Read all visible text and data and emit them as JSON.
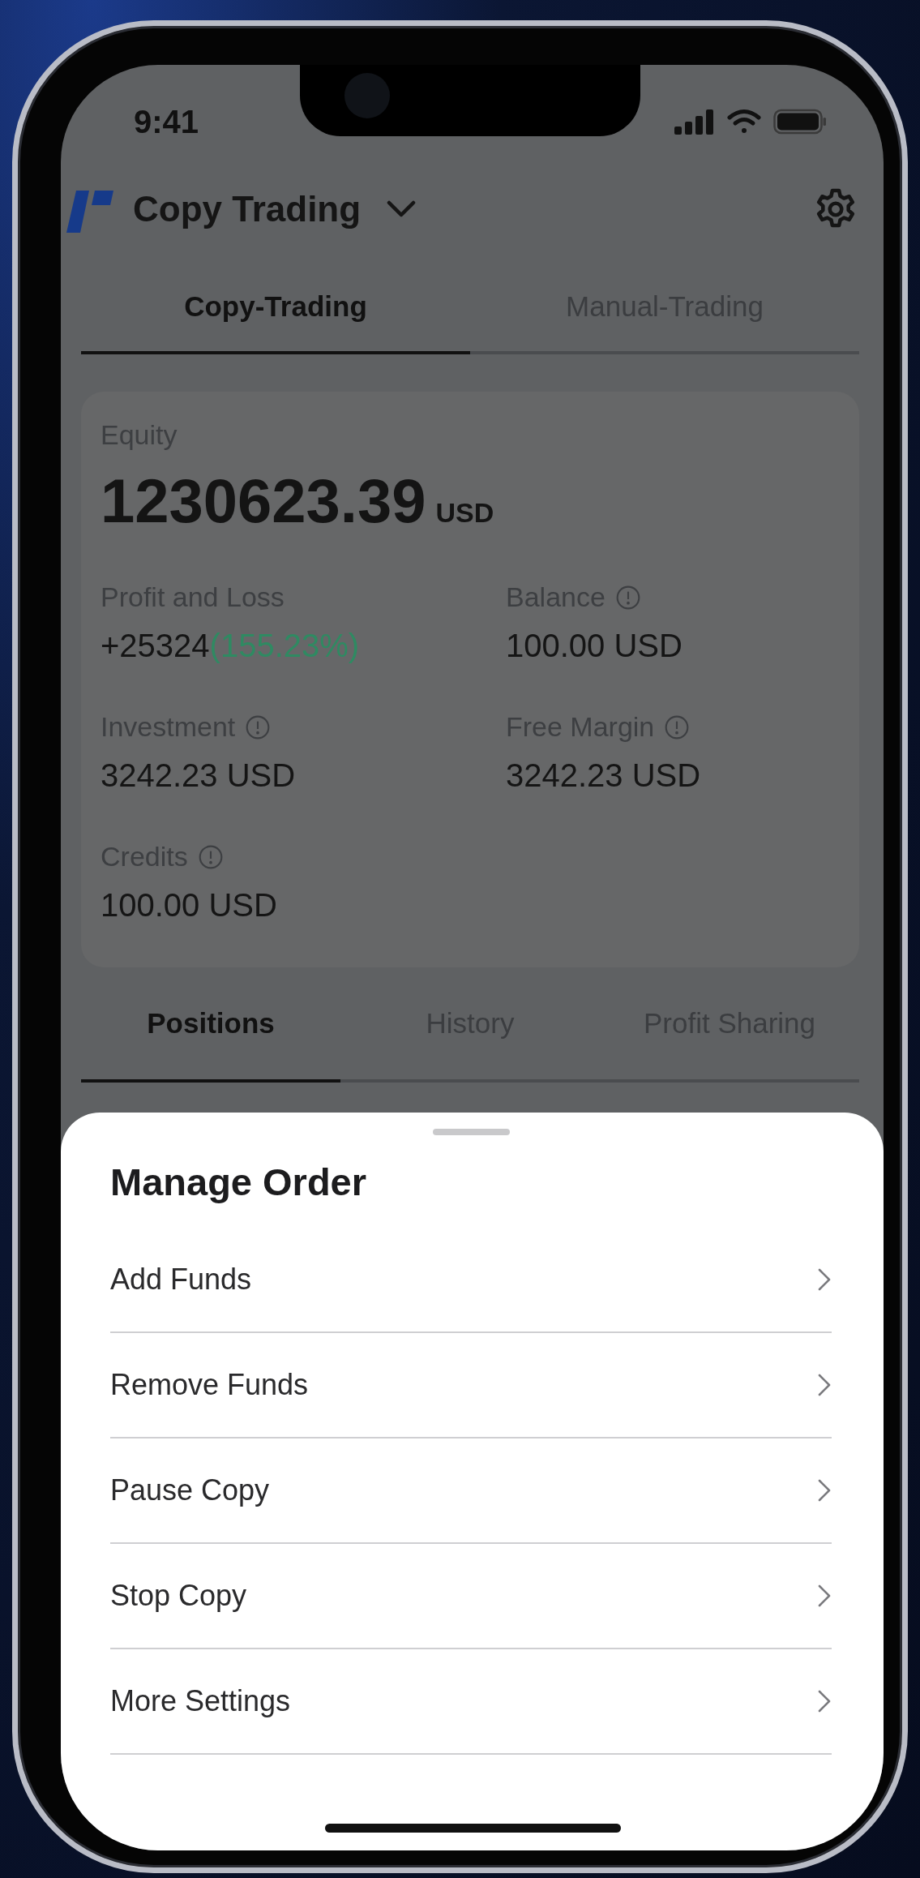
{
  "status_bar": {
    "time": "9:41"
  },
  "header": {
    "title": "Copy Trading"
  },
  "mode_tabs": [
    {
      "label": "Copy-Trading",
      "selected": true
    },
    {
      "label": "Manual-Trading",
      "selected": false
    }
  ],
  "account": {
    "equity_label": "Equity",
    "equity_value": "1230623.39",
    "equity_currency": "USD",
    "metrics": [
      {
        "label": "Profit and Loss",
        "value": "+25324",
        "change": "(155.23%)",
        "info": false
      },
      {
        "label": "Balance",
        "value": "100.00 USD",
        "info": true
      },
      {
        "label": "Investment",
        "value": "3242.23 USD",
        "info": true
      },
      {
        "label": "Free Margin",
        "value": "3242.23 USD",
        "info": true
      },
      {
        "label": "Credits",
        "value": "100.00 USD",
        "info": true
      }
    ]
  },
  "order_tabs": [
    {
      "label": "Positions",
      "selected": true
    },
    {
      "label": "History",
      "selected": false
    },
    {
      "label": "Profit Sharing",
      "selected": false
    }
  ],
  "sheet": {
    "title": "Manage Order",
    "items": [
      {
        "label": "Add Funds"
      },
      {
        "label": "Remove Funds"
      },
      {
        "label": "Pause Copy"
      },
      {
        "label": "Stop Copy"
      },
      {
        "label": "More Settings"
      }
    ]
  }
}
